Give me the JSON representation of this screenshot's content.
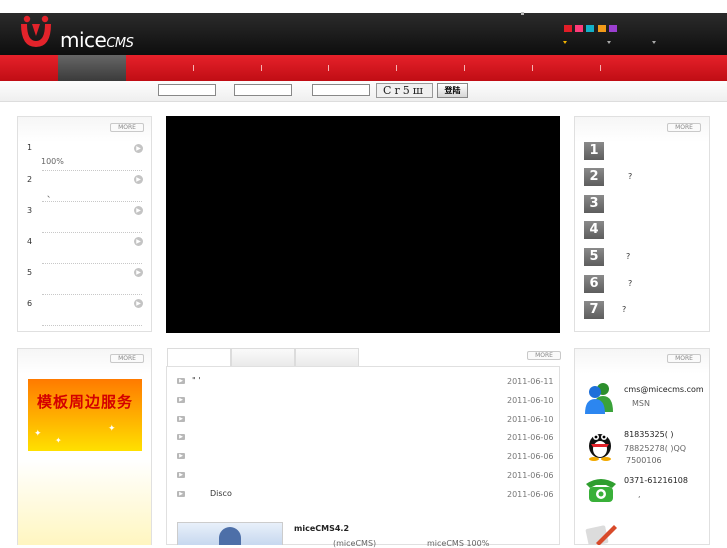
{
  "brand": {
    "logo_main": "mice",
    "logo_suffix": "CMS"
  },
  "header": {
    "swatch_colors": [
      "#e11d27",
      "#ff3b7a",
      "#14b0c9",
      "#f29a18",
      "#9b3fd0"
    ]
  },
  "login": {
    "captcha_text": "Cr5ш",
    "login_label": "登陆"
  },
  "more_label": "MORE",
  "left_list": {
    "items": [
      {
        "num": "1",
        "sub": "100%"
      },
      {
        "num": "2",
        "sub": "、"
      },
      {
        "num": "3",
        "sub": ""
      },
      {
        "num": "4",
        "sub": ""
      },
      {
        "num": "5",
        "sub": ""
      },
      {
        "num": "6",
        "sub": ""
      }
    ]
  },
  "rank_list": {
    "items": [
      {
        "num": "1",
        "text": ""
      },
      {
        "num": "2",
        "text": "?"
      },
      {
        "num": "3",
        "text": ""
      },
      {
        "num": "4",
        "text": ""
      },
      {
        "num": "5",
        "text": "?"
      },
      {
        "num": "6",
        "text": "?"
      },
      {
        "num": "7",
        "text": "?"
      }
    ]
  },
  "promo": {
    "text": "模板周边服务"
  },
  "news": {
    "items": [
      {
        "title": "\"   '",
        "date": "2011-06-11"
      },
      {
        "title": "",
        "date": "2011-06-10"
      },
      {
        "title": "",
        "date": "2011-06-10"
      },
      {
        "title": "",
        "date": "2011-06-06"
      },
      {
        "title": "",
        "date": "2011-06-06"
      },
      {
        "title": "",
        "date": "2011-06-06"
      },
      {
        "title": "Disco",
        "date": "2011-06-06"
      }
    ],
    "feature_title": "miceCMS4.2",
    "feature_line_a": "(miceCMS)",
    "feature_line_b": "miceCMS 100%"
  },
  "contact": {
    "email": "cms@micecms.com",
    "msn_label": "MSN",
    "qq_primary": "81835325(  )",
    "qq_secondary": "78825278(  )QQ",
    "qq_tertiary": "7500106",
    "phone": "0371-61216108",
    "phone_sub": ","
  }
}
